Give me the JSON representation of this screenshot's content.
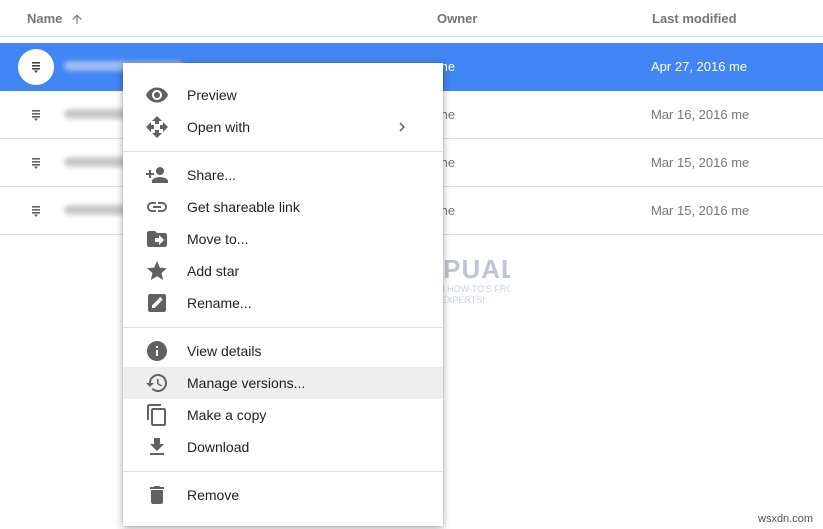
{
  "columns": {
    "name": "Name",
    "owner": "Owner",
    "modified": "Last modified"
  },
  "rows": [
    {
      "owner": "me",
      "modified": "Apr 27, 2016  me",
      "selected": true
    },
    {
      "owner": "me",
      "modified": "Mar 16, 2016  me",
      "selected": false
    },
    {
      "owner": "me",
      "modified": "Mar 15, 2016  me",
      "selected": false
    },
    {
      "owner": "me",
      "modified": "Mar 15, 2016  me",
      "selected": false
    }
  ],
  "menu": {
    "preview": "Preview",
    "open_with": "Open with",
    "share": "Share...",
    "get_link": "Get shareable link",
    "move_to": "Move to...",
    "add_star": "Add star",
    "rename": "Rename...",
    "view_details": "View details",
    "manage_versions": "Manage versions...",
    "make_copy": "Make a copy",
    "download": "Download",
    "remove": "Remove"
  },
  "watermark": {
    "brand": "APPUALS",
    "tagline_1": "TECH HOW-TO'S FROM",
    "tagline_2": "THE EXPERTS!"
  },
  "credit": "wsxdn.com",
  "colors": {
    "selection": "#4285f4",
    "icon": "#616161",
    "hover": "#eeeeee"
  }
}
